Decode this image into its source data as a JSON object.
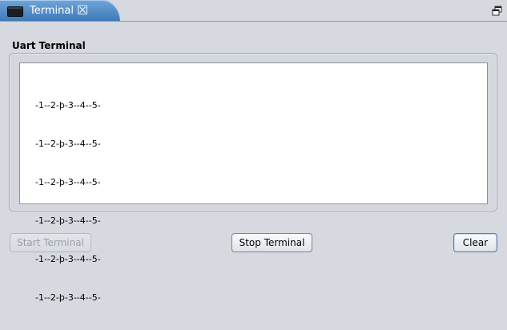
{
  "tab": {
    "title": "Terminal",
    "close_symbol": "☒",
    "icon": "terminal-window-icon"
  },
  "window_controls": {
    "restore_icon": "restore-window-icon"
  },
  "panel": {
    "label": "Uart Terminal",
    "terminal_lines": [
      "-1--2-þ-3--4--5-",
      "-1--2-þ-3--4--5-",
      "-1--2-þ-3--4--5-",
      "-1--2-þ-3--4--5-",
      "-1--2-þ-3--4--5-",
      "-1--2-þ-3--4--5-"
    ]
  },
  "buttons": {
    "start_label": "Start Terminal",
    "stop_label": "Stop Terminal",
    "clear_label": "Clear"
  },
  "colors": {
    "tab_accent": "#3c78b8",
    "background": "#d6d9df"
  }
}
